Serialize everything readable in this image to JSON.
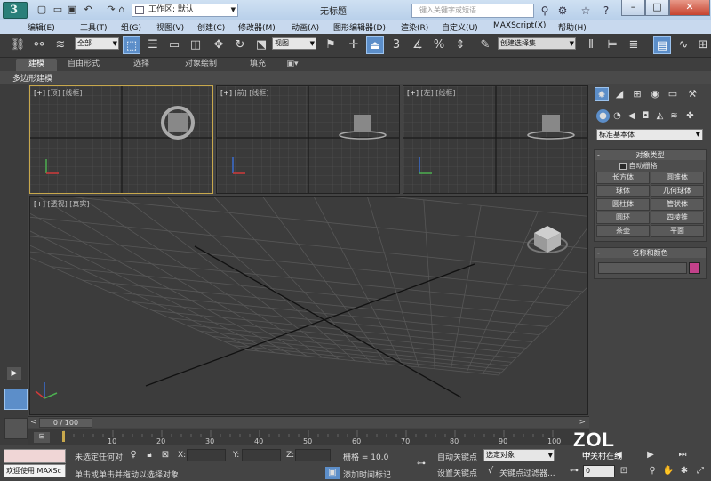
{
  "window": {
    "title": "无标题",
    "workspace_label": "工作区: 默认",
    "search_placeholder": "键入关键字或短语"
  },
  "menu": [
    "编辑(E)",
    "工具(T)",
    "组(G)",
    "视图(V)",
    "创建(C)",
    "修改器(M)",
    "动画(A)",
    "图形编辑器(D)",
    "渲染(R)",
    "自定义(U)",
    "MAXScript(X)",
    "帮助(H)"
  ],
  "toolbar": {
    "selection_filter": "全部",
    "ref_coord": "视图",
    "snap_value": "3",
    "named_selection": "创建选择集"
  },
  "ribbon": {
    "tabs": [
      "建模",
      "自由形式",
      "选择",
      "对象绘制",
      "填充"
    ],
    "active_tab": "建模",
    "subtitle": "多边形建模"
  },
  "viewports": {
    "top": {
      "a": "[+]",
      "b": "[顶]",
      "c": "[线框]"
    },
    "front": {
      "a": "[+]",
      "b": "[前]",
      "c": "[线框]"
    },
    "left": {
      "a": "[+]",
      "b": "[左]",
      "c": "[线框]"
    },
    "persp": {
      "a": "[+]",
      "b": "[透视]",
      "c": "[真实]"
    }
  },
  "command_panel": {
    "category": "标准基本体",
    "object_type_title": "对象类型",
    "autogrid_label": "自动栅格",
    "buttons": [
      "长方体",
      "圆锥体",
      "球体",
      "几何球体",
      "圆柱体",
      "管状体",
      "圆环",
      "四棱锥",
      "茶壶",
      "平面"
    ],
    "name_color_title": "名称和颜色",
    "object_color": "#c2418a"
  },
  "timeline": {
    "frame_display": "0 / 100",
    "ticks": [
      "10",
      "20",
      "30",
      "40",
      "50",
      "60",
      "70",
      "80",
      "90",
      "100"
    ]
  },
  "status": {
    "welcome": "欢迎使用 MAXSc",
    "selection_status": "未选定任何对",
    "prompt": "单击或单击并拖动以选择对象",
    "x_label": "X:",
    "y_label": "Y:",
    "z_label": "Z:",
    "grid": "栅格 = 10.0",
    "add_time_tag": "添加时间标记",
    "auto_key": "自动关键点",
    "set_key": "设置关键点",
    "key_mode": "选定对象",
    "key_filters": "关键点过滤器...",
    "frame_value": "0"
  },
  "watermark": {
    "logo": "ZOL",
    "sub": "中关村在线"
  }
}
